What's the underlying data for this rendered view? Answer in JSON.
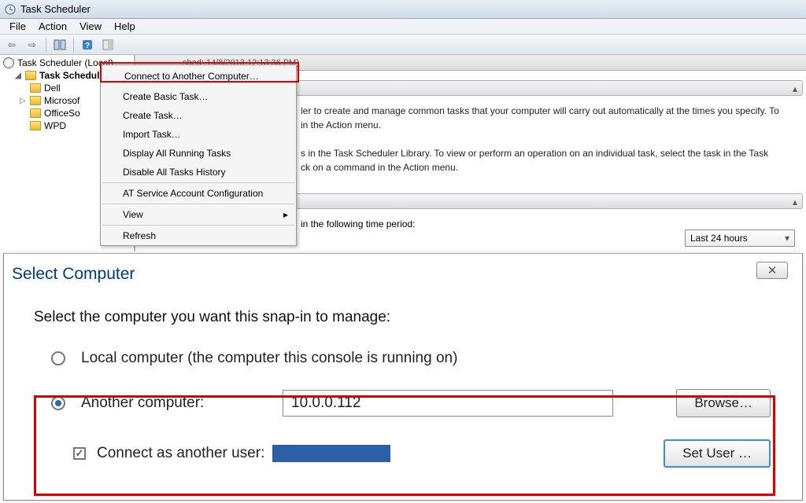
{
  "window": {
    "title": "Task Scheduler"
  },
  "menubar": {
    "file": "File",
    "action": "Action",
    "view": "View",
    "help": "Help"
  },
  "tree": {
    "root": "Task Scheduler (Local)",
    "library": "Task Schedul",
    "items": [
      {
        "label": "Dell"
      },
      {
        "label": "Microsof"
      },
      {
        "label": "OfficeSo"
      },
      {
        "label": "WPD"
      }
    ]
  },
  "context_menu": {
    "connect": "Connect to Another Computer…",
    "create_basic": "Create Basic Task…",
    "create_task": "Create Task…",
    "import": "Import Task…",
    "display_running": "Display All Running Tasks",
    "disable_history": "Disable All Tasks History",
    "at_service": "AT Service Account Configuration",
    "view": "View",
    "refresh": "Refresh"
  },
  "summary": {
    "refreshed": "shed: 14/8/2013 12:13:36 PM)",
    "overview1": "ler to create and manage common tasks that your computer will carry out automatically at the times you specify. To",
    "overview1b": "in the Action menu.",
    "overview2": "s in the Task Scheduler Library. To view or perform an operation on an individual task, select the task in the Task",
    "overview2b": "ck on a command in the Action menu.",
    "status_label": "in the following time period:",
    "period": "Last 24 hours"
  },
  "dialog": {
    "title": "Select Computer",
    "heading": "Select the computer you want this snap-in to manage:",
    "local_label": "Local computer (the computer this console is running on)",
    "another_label": "Another computer:",
    "computer_value": "10.0.0.112",
    "browse": "Browse…",
    "connect_as": "Connect as another user:",
    "set_user": "Set User …"
  }
}
